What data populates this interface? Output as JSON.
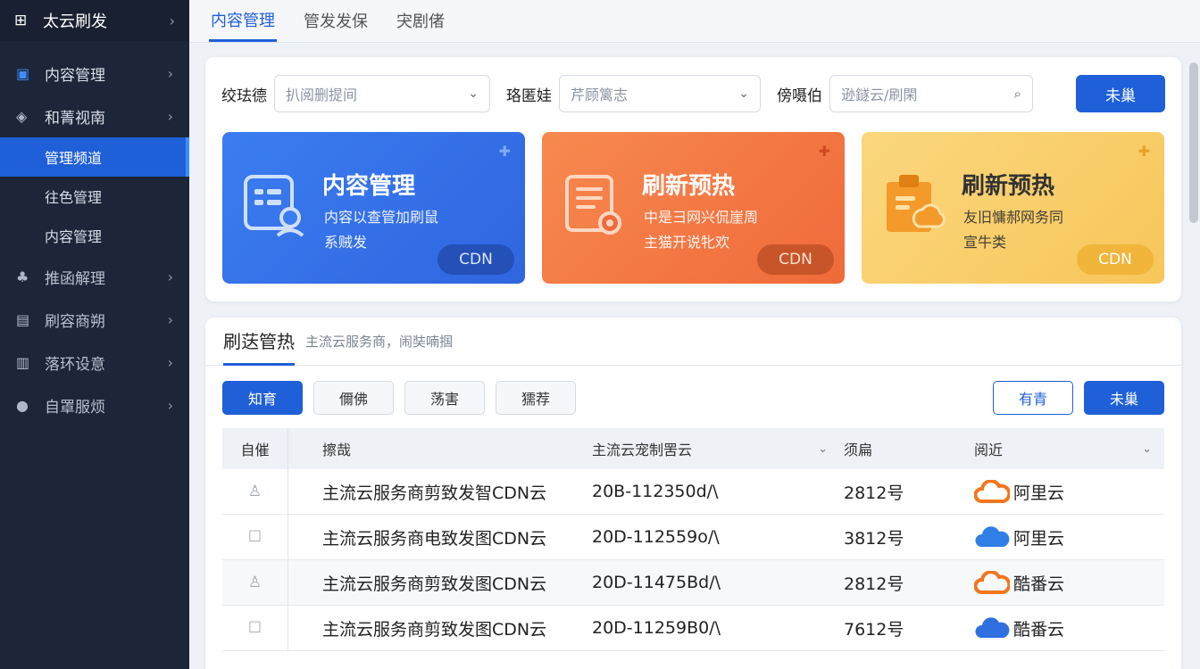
{
  "sidebar": {
    "brand": "太云刷发",
    "items": [
      {
        "label": "内容管理"
      },
      {
        "label": "和菁视南"
      }
    ],
    "subitems": [
      {
        "label": "管理频道"
      },
      {
        "label": "往色管理"
      },
      {
        "label": "内容管理"
      }
    ],
    "items2": [
      {
        "label": "推函解理"
      },
      {
        "label": "刷容商朔"
      },
      {
        "label": "落环设意"
      },
      {
        "label": "自罩服烦"
      }
    ]
  },
  "tabs": [
    {
      "label": "内容管理"
    },
    {
      "label": "管发发保"
    },
    {
      "label": "宊剧偖"
    }
  ],
  "filters": {
    "label1": "绞珐德",
    "select1": "扒阅删提间",
    "label2": "珞匿娃",
    "select2": "芹顾篱志",
    "label3": "傍嗫伯",
    "search_placeholder": "逊鐩云/刷閑",
    "submit": "未巢"
  },
  "cards": [
    {
      "title": "内容管理",
      "desc1": "内容以查管加刷鼠",
      "desc2": "系贼发",
      "chip": "CDN",
      "color": "#3b7cf0"
    },
    {
      "title": "刷新预热",
      "desc1": "中是彐网兴侃崖周",
      "desc2": "主猫开说牝欢",
      "chip": "CDN",
      "color": "#f7894f"
    },
    {
      "title": "刷新预热",
      "desc1": "友旧慵郝网务同",
      "desc2": "宣牛类",
      "chip": "CDN",
      "color": "#fbd77e"
    }
  ],
  "section": {
    "title": "刷荙管热",
    "subtitle": "主流云服务商，闹奘喃掴"
  },
  "toolbar": {
    "btn1": "知育",
    "btn2": "儞佛",
    "btn3": "荡害",
    "btn4": "獳荐",
    "btn_outline": "有青",
    "btn_primary": "未巢"
  },
  "table": {
    "headers": [
      "自催",
      "擦哉",
      "主流云宠制罟云",
      "须扁",
      "阅近"
    ],
    "rows": [
      {
        "name": "主流云服务商剪致发智CDN云",
        "code": "20B-112350d/\\",
        "count": "2812号",
        "vendor": "阿里云",
        "cloud": "orange",
        "check": "person"
      },
      {
        "name": "主流云服务商电致发图CDN云",
        "code": "20D-112559o/\\",
        "count": "3812号",
        "vendor": "阿里云",
        "cloud": "blue",
        "check": "box"
      },
      {
        "name": "主流云服务商剪致发图CDN云",
        "code": "20D-11475Bd/\\",
        "count": "2812号",
        "vendor": "酷番云",
        "cloud": "orange",
        "check": "person"
      },
      {
        "name": "主流云服务商剪致发图CDN云",
        "code": "20D-11259B0/\\",
        "count": "7612号",
        "vendor": "酷番云",
        "cloud": "blue",
        "check": "box"
      }
    ]
  },
  "colors": {
    "sidebar_bg": "#1d2638",
    "accent": "#1f5fd8",
    "card_blue": "#3b7cf0",
    "card_orange": "#f7894f",
    "card_yellow": "#fbd77e"
  }
}
